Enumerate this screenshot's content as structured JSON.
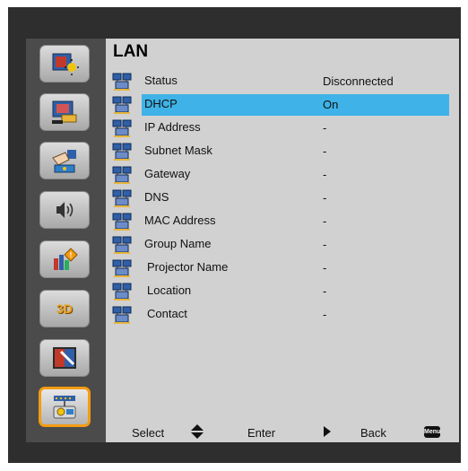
{
  "panel": {
    "title": "LAN"
  },
  "sidebar": {
    "items": [
      {
        "name": "image-settings-icon"
      },
      {
        "name": "display-settings-icon"
      },
      {
        "name": "setup-icon"
      },
      {
        "name": "audio-icon"
      },
      {
        "name": "options-info-icon"
      },
      {
        "name": "3d-icon",
        "label": "3D"
      },
      {
        "name": "color-settings-icon"
      },
      {
        "name": "lan-icon",
        "active": true
      }
    ]
  },
  "rows": [
    {
      "label": "Status",
      "value": "Disconnected"
    },
    {
      "label": "DHCP",
      "value": "On",
      "selected": true
    },
    {
      "label": "IP Address",
      "value": "-"
    },
    {
      "label": "Subnet Mask",
      "value": "-"
    },
    {
      "label": "Gateway",
      "value": "-"
    },
    {
      "label": "DNS",
      "value": "-"
    },
    {
      "label": "MAC Address",
      "value": "-"
    },
    {
      "label": "Group Name",
      "value": "-"
    },
    {
      "label": "Projector Name",
      "value": "-"
    },
    {
      "label": "Location",
      "value": "-"
    },
    {
      "label": "Contact",
      "value": "-"
    }
  ],
  "footer": {
    "select_label": "Select",
    "enter_label": "Enter",
    "back_label": "Back",
    "menu_key_label": "Menu"
  },
  "colors": {
    "highlight": "#3fb3e8",
    "active_border": "#f39c12",
    "panel_bg": "#d1d1d1",
    "frame_bg": "#2e2e2e"
  }
}
